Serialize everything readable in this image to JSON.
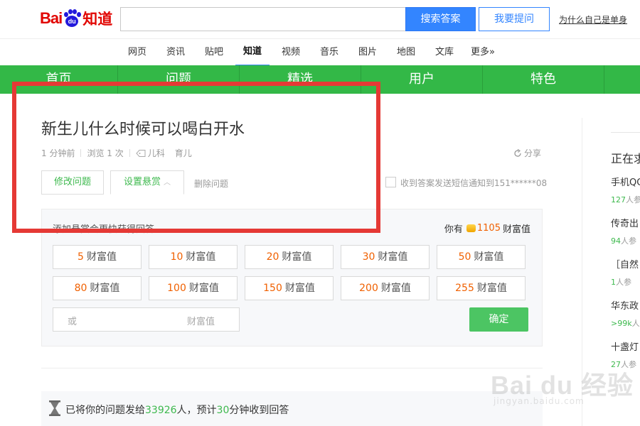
{
  "header": {
    "logo": {
      "bai": "Bai",
      "du": "du",
      "zhidao": "知道"
    },
    "search": {
      "value": "",
      "button": "搜索答案"
    },
    "ask_button": "我要提问",
    "top_link": "为什么自己是单身"
  },
  "channels": [
    "网页",
    "资讯",
    "贴吧",
    "知道",
    "视频",
    "音乐",
    "图片",
    "地图",
    "文库",
    "更多»"
  ],
  "active_channel": "知道",
  "green_nav": [
    "首页",
    "问题",
    "精选",
    "用户",
    "特色"
  ],
  "question": {
    "title": "新生儿什么时候可以喝白开水",
    "time": "1 分钟前",
    "views": "浏览 1 次",
    "tag1": "儿科",
    "tag2": "育儿",
    "share": "分享"
  },
  "actions": {
    "edit": "修改问题",
    "reward": "设置悬赏",
    "delete": "删除问题",
    "sms_label": "收到答案发送短信通知到151******08"
  },
  "reward_panel": {
    "hint": "添加悬赏会更快获得回答",
    "balance_prefix": "你有",
    "balance_amount": "1105",
    "balance_unit": "财富值",
    "options": [
      {
        "num": "5",
        "unit": "财富值"
      },
      {
        "num": "10",
        "unit": "财富值"
      },
      {
        "num": "20",
        "unit": "财富值"
      },
      {
        "num": "30",
        "unit": "财富值"
      },
      {
        "num": "50",
        "unit": "财富值"
      },
      {
        "num": "80",
        "unit": "财富值"
      },
      {
        "num": "100",
        "unit": "财富值"
      },
      {
        "num": "150",
        "unit": "财富值"
      },
      {
        "num": "200",
        "unit": "财富值"
      },
      {
        "num": "255",
        "unit": "财富值"
      }
    ],
    "custom_or": "或",
    "custom_unit": "财富值",
    "confirm": "确定"
  },
  "notice": {
    "prefix": "已将你的问题发给",
    "people": "33926",
    "mid": "人，预计",
    "minutes": "30",
    "suffix": "分钟收到回答"
  },
  "sidebar": {
    "title": "正在求",
    "items": [
      {
        "title": "手机QC",
        "meta_num": "127",
        "meta_txt": "人参"
      },
      {
        "title": "传奇出",
        "meta_num": "94",
        "meta_txt": "人参"
      },
      {
        "title": "［自然",
        "meta_num": "1",
        "meta_txt": "人参"
      },
      {
        "title": "华东政",
        "meta_num": ">99k",
        "meta_txt": "人"
      },
      {
        "title": "十盏灯",
        "meta_num": "27",
        "meta_txt": "人参"
      }
    ]
  },
  "watermark": {
    "brand": "Bai du 经验",
    "url": "jingyan.baidu.com"
  },
  "colors": {
    "green": "#33b847",
    "blue": "#3385ff",
    "orange": "#f06000",
    "annotation": "#e53935"
  }
}
